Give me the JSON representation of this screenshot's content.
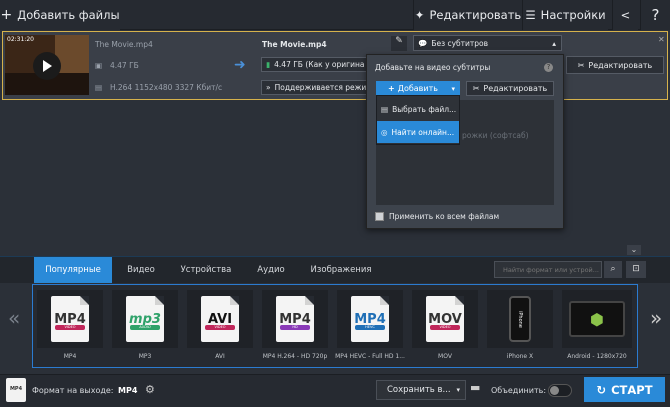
{
  "toolbar": {
    "add_files": "Добавить файлы",
    "edit": "Редактировать",
    "settings": "Настройки"
  },
  "file": {
    "time": "02:31:20",
    "name": "The Movie.mp4",
    "size": "4.47 ГБ",
    "meta": "H.264 1152x480 3327 Кбит/с",
    "out_name": "The Movie.mp4",
    "out_size": "4.47 ГБ (Как у оригина",
    "support": "Поддерживается режим",
    "subtitles": "Без субтитров",
    "edit_label": "Редактировать"
  },
  "popup": {
    "title": "Добавьте на видео субтитры",
    "add": "Добавить",
    "edit": "Редактировать",
    "menu": [
      "Выбрать файл...",
      "Найти онлайн..."
    ],
    "hint": "рожки (софтсаб)",
    "apply_all": "Применить ко всем файлам"
  },
  "tabs": [
    "Популярные",
    "Видео",
    "Устройства",
    "Аудио",
    "Изображения"
  ],
  "search": {
    "placeholder": "Найти формат или устрой..."
  },
  "formats": [
    {
      "label": "MP4",
      "icon": "MP4"
    },
    {
      "label": "MP3",
      "icon": "mp3"
    },
    {
      "label": "AVI",
      "icon": "AVI"
    },
    {
      "label": "MP4 H.264 - HD 720p",
      "icon": "MP4"
    },
    {
      "label": "MP4 HEVC - Full HD 1...",
      "icon": "MP4"
    },
    {
      "label": "MOV",
      "icon": "MOV"
    },
    {
      "label": "iPhone X",
      "icon": "iPhone"
    },
    {
      "label": "Android - 1280x720",
      "icon": "android"
    }
  ],
  "bottom": {
    "out_format_label": "Формат на выходе:",
    "out_format": "MP4",
    "save": "Сохранить в...",
    "merge": "Объединить:",
    "start": "СТАРТ"
  },
  "colors": {
    "accent": "#2a8ad8",
    "selected_border": "#d6b24c"
  }
}
